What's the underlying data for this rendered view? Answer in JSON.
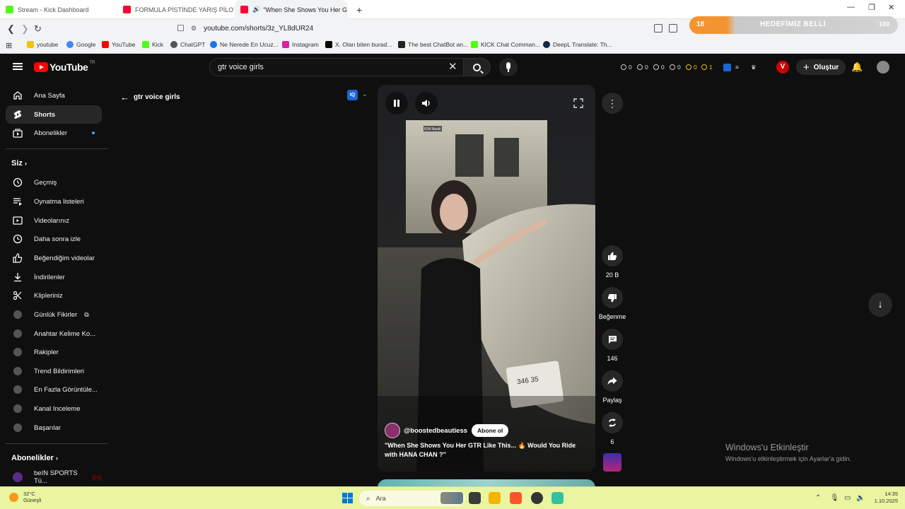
{
  "browser": {
    "tabs": [
      {
        "title": "Stream - Kick Dashboard",
        "color": "#53fc18"
      },
      {
        "title": "FORMULA PİSTİNDE YARIŞ PİLOTUYL",
        "color": "#ff0033"
      },
      {
        "title": "\"When She Shows You Her G",
        "color": "#ff0033"
      }
    ],
    "new_tab": "+",
    "url": "youtube.com/shorts/3z_YL8dUR24",
    "pill": {
      "number": "18",
      "goal_text": "HEDEFİMİZ BELLİ",
      "target": "100",
      "progress": 0.18
    },
    "bookmarks": [
      {
        "label": "youtube",
        "color": "#f4c20d"
      },
      {
        "label": "Google",
        "color": "#4285f4"
      },
      {
        "label": "YouTube",
        "color": "#ff0000"
      },
      {
        "label": "Kick",
        "color": "#53fc18"
      },
      {
        "label": "ChatGPT",
        "color": "#555555"
      },
      {
        "label": "Ne Nerede En Ucuz...",
        "color": "#1a73e8"
      },
      {
        "label": "Instagram",
        "color": "#d6249f"
      },
      {
        "label": "X. Olan biten burad...",
        "color": "#000000"
      },
      {
        "label": "The best ChatBot an...",
        "color": "#222222"
      },
      {
        "label": "KICK Chat Comman...",
        "color": "#53fc18"
      },
      {
        "label": "DeepL Translate: Th...",
        "color": "#0f2b46"
      }
    ]
  },
  "header": {
    "logo": "YouTube",
    "logo_suffix": "TR",
    "search_value": "gtr voice girls",
    "stats": [
      "0",
      "0",
      "0",
      "0",
      "0",
      "1"
    ],
    "v_badge": "V",
    "create_label": "Oluştur"
  },
  "sidebar": {
    "top": [
      {
        "label": "Ana Sayfa",
        "icon": "home-icon"
      },
      {
        "label": "Shorts",
        "icon": "shorts-icon"
      },
      {
        "label": "Abonelikler",
        "icon": "subscriptions-icon"
      }
    ],
    "you_heading": "Siz",
    "you_items": [
      {
        "label": "Geçmiş",
        "icon": "history-icon"
      },
      {
        "label": "Oynatma listeleri",
        "icon": "playlist-icon"
      },
      {
        "label": "Videolarınız",
        "icon": "your-videos-icon"
      },
      {
        "label": "Daha sonra izle",
        "icon": "watch-later-icon"
      },
      {
        "label": "Beğendiğim videolar",
        "icon": "liked-icon"
      },
      {
        "label": "İndirilenler",
        "icon": "download-icon"
      },
      {
        "label": "Klipleriniz",
        "icon": "clips-icon"
      },
      {
        "label": "Günlük Fikirler",
        "icon": "vidiq-icon"
      },
      {
        "label": "Anahtar Kelime Ko...",
        "icon": "vidiq-icon"
      },
      {
        "label": "Rakipler",
        "icon": "vidiq-icon"
      },
      {
        "label": "Trend Bildirimleri",
        "icon": "vidiq-icon"
      },
      {
        "label": "En Fazla Görüntüle...",
        "icon": "vidiq-icon"
      },
      {
        "label": "Kanal Inceleme",
        "icon": "vidiq-icon"
      },
      {
        "label": "Başarılar",
        "icon": "vidiq-icon"
      }
    ],
    "subs_heading": "Abonelikler",
    "subs_items": [
      {
        "label": "beIN SPORTS Tü..."
      }
    ]
  },
  "main": {
    "back_label": "gtr voice girls",
    "iq_badge": "IQ",
    "video": {
      "overlay_text": "R34 Naoki",
      "handle": "@boostedbeautiess",
      "subscribe": "Abone ol",
      "title": "\"When She Shows You Her GTR Like This... 🔥 Would You Ride with HANA CHAN ?\"",
      "plate": "346 35"
    },
    "actions": [
      {
        "label": "20 B",
        "icon": "like-icon"
      },
      {
        "label": "Beğenme",
        "icon": "dislike-icon"
      },
      {
        "label": "146",
        "icon": "comment-icon"
      },
      {
        "label": "Paylaş",
        "icon": "share-icon"
      },
      {
        "label": "6",
        "icon": "remix-icon"
      }
    ]
  },
  "watermark": {
    "title": "Windows'u Etkinleştir",
    "subtitle": "Windows'u etkinleştirmek için Ayarlar'a gidin."
  },
  "taskbar": {
    "temperature": "32°C",
    "weather": "Güneşli",
    "search_placeholder": "Ara",
    "time": "14:35",
    "date": "1.10.2025"
  }
}
